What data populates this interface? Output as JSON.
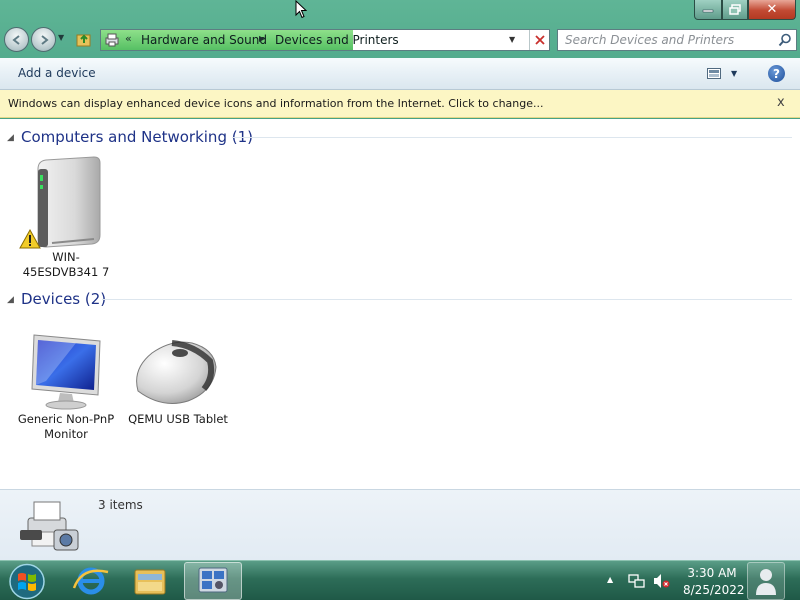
{
  "window": {
    "caption_buttons": {
      "minimize": "",
      "maximize": "",
      "close": "✕"
    }
  },
  "navigation": {
    "back_icon": "back-arrow-icon",
    "forward_icon": "forward-arrow-icon",
    "breadcrumb_prefix": "«",
    "breadcrumbs": [
      "Hardware and Sound",
      "Devices and Printers"
    ],
    "search_placeholder": "Search Devices and Printers"
  },
  "command_bar": {
    "add_device_label": "Add a device",
    "help_label": "?"
  },
  "infobar": {
    "text": "Windows can display enhanced device icons and information from the Internet. Click to change...",
    "close_label": "x"
  },
  "groups": [
    {
      "title": "Computers and Networking (1)",
      "items": [
        {
          "label": "WIN-45ESDVB341 7",
          "icon": "computer-tower-icon",
          "warning": true
        }
      ]
    },
    {
      "title": "Devices (2)",
      "items": [
        {
          "label": "Generic Non-PnP Monitor",
          "icon": "monitor-icon"
        },
        {
          "label": "QEMU USB Tablet",
          "icon": "mouse-icon"
        }
      ]
    }
  ],
  "details_pane": {
    "item_count": "3 items"
  },
  "taskbar": {
    "clock_time": "3:30 AM",
    "clock_date": "8/25/2022",
    "pinned": [
      "internet-explorer-icon",
      "windows-explorer-icon",
      "devices-and-printers-icon"
    ]
  },
  "colors": {
    "group_title": "#1e3287",
    "infobar_bg": "#fcf6c4",
    "chrome_accent": "#3f9a7c"
  }
}
